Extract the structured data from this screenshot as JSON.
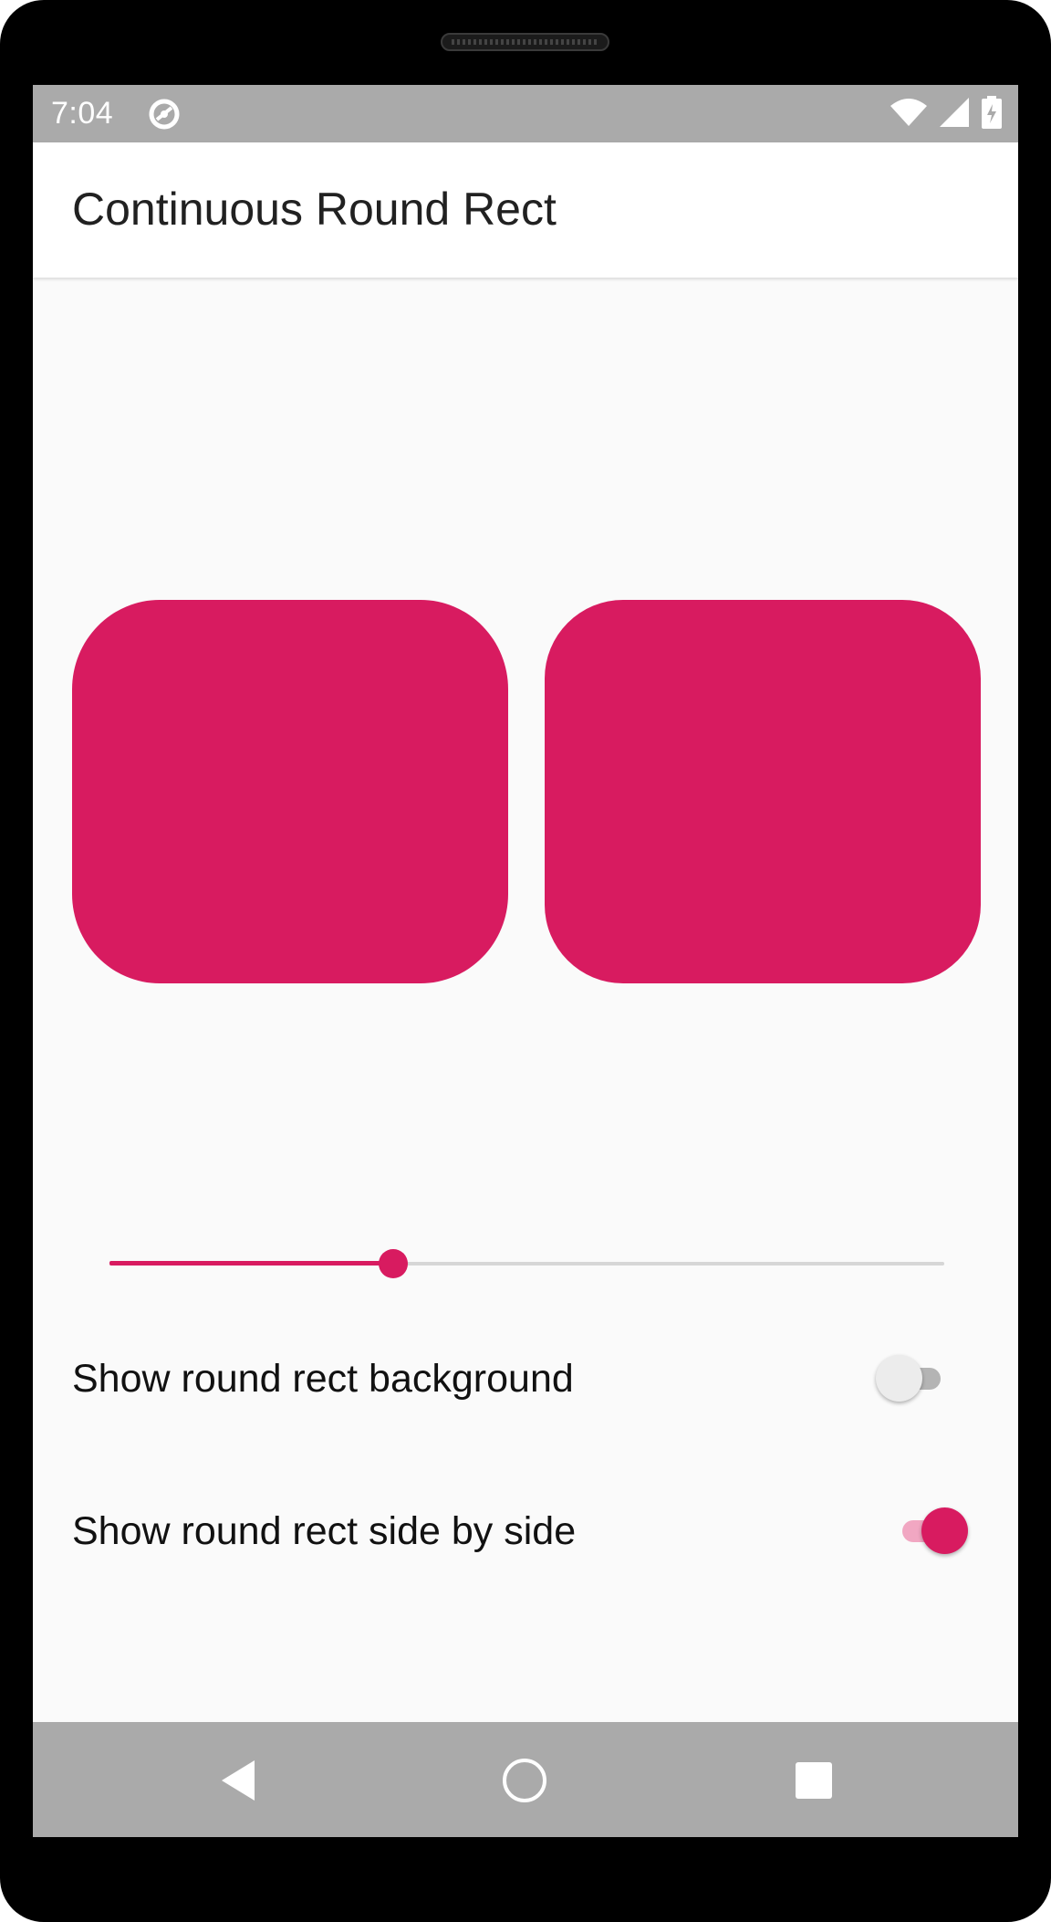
{
  "status_bar": {
    "time": "7:04",
    "icons": [
      "app-notification-icon",
      "wifi-icon",
      "cell-signal-icon",
      "battery-charging-icon"
    ]
  },
  "app_bar": {
    "title": "Continuous Round Rect"
  },
  "shapes": [
    {
      "name": "continuous-round-rect",
      "color": "#d81b60"
    },
    {
      "name": "round-rect",
      "color": "#d81b60"
    }
  ],
  "slider": {
    "value_fraction": 0.34,
    "accent": "#d81b60"
  },
  "settings": [
    {
      "label": "Show round rect background",
      "enabled": false
    },
    {
      "label": "Show round rect side by side",
      "enabled": true
    }
  ],
  "navigation": {
    "buttons": [
      "back-icon",
      "home-icon",
      "recents-icon"
    ]
  },
  "colors": {
    "accent": "#d81b60",
    "system_bars": "#aaaaaa",
    "background": "#fafafa"
  }
}
